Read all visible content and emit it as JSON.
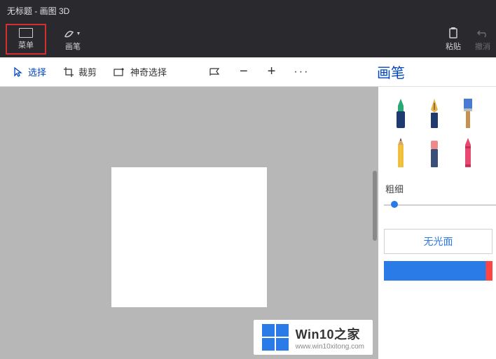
{
  "title": "无标题 - 画图 3D",
  "topbar": {
    "menu_label": "菜单",
    "brush_label": "画笔",
    "paste_label": "粘贴",
    "undo_label": "撤消"
  },
  "toolbar": {
    "select_label": "选择",
    "crop_label": "裁剪",
    "magic_label": "神奇选择"
  },
  "sidebar": {
    "panel_title": "画笔",
    "thickness_label": "粗细",
    "matte_label": "无光面",
    "brushes": [
      "marker",
      "calligraphy-pen",
      "flat-brush",
      "pencil",
      "eraser",
      "crayon"
    ]
  },
  "watermark": {
    "title": "Win10之家",
    "url": "www.win10xitong.com"
  }
}
